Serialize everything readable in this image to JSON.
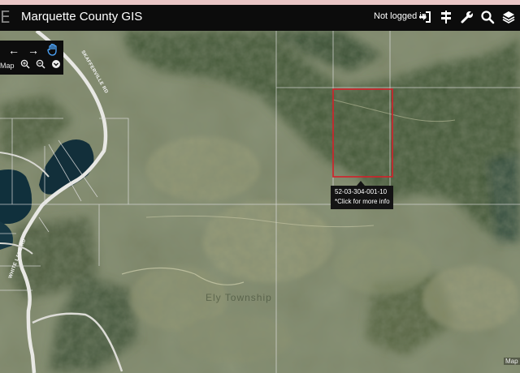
{
  "header": {
    "logo_glyph": "E",
    "title": "Marquette County GIS",
    "login_status": "Not logged in",
    "icons": [
      "sign-in-icon",
      "signpost-icon",
      "wrench-icon",
      "search-icon",
      "layers-icon"
    ]
  },
  "toolbar": {
    "back_glyph": "←",
    "forward_glyph": "→",
    "pan_icon": "hand-icon",
    "map_label": "Map",
    "zoom_in_icon": "zoom-in-icon",
    "zoom_out_icon": "zoom-out-icon",
    "down_icon": "chevron-down-circle-icon"
  },
  "parcel_tooltip": {
    "parcel_id": "52-03-304-001-10",
    "hint": "*Click for more info"
  },
  "map_labels": {
    "township": "Ely Township",
    "road_1": "SKAFFERVILLE RD",
    "road_2": "WHITE LAKE RD"
  },
  "attribution": "Map",
  "colors": {
    "header_bg": "#0c0c0c",
    "parcel_highlight": "#d4202a",
    "tooltip_bg": "#141414",
    "top_strip": "#e9c6c6"
  }
}
